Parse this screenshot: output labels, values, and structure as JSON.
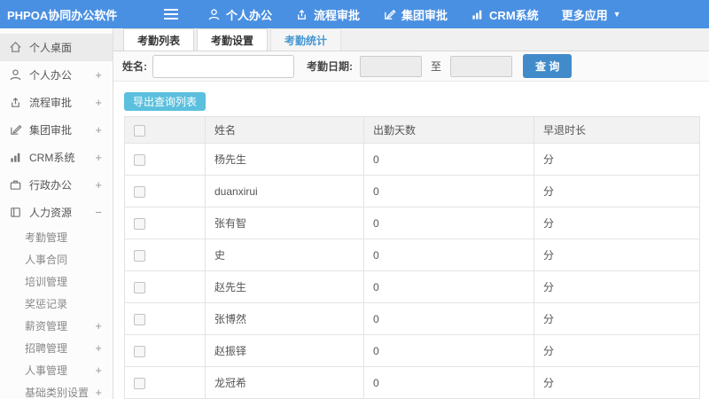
{
  "app": {
    "title": "PHPOA协同办公软件"
  },
  "topnav": {
    "items": [
      {
        "label": "个人办公"
      },
      {
        "label": "流程审批"
      },
      {
        "label": "集团审批"
      },
      {
        "label": "CRM系统"
      },
      {
        "label": "更多应用"
      }
    ]
  },
  "sidebar": {
    "items": [
      {
        "label": "个人桌面",
        "expander": ""
      },
      {
        "label": "个人办公",
        "expander": "+"
      },
      {
        "label": "流程审批",
        "expander": "+"
      },
      {
        "label": "集团审批",
        "expander": "+"
      },
      {
        "label": "CRM系统",
        "expander": "+"
      },
      {
        "label": "行政办公",
        "expander": "+"
      },
      {
        "label": "人力资源",
        "expander": "−"
      }
    ],
    "subitems": [
      {
        "label": "考勤管理",
        "expander": ""
      },
      {
        "label": "人事合同",
        "expander": ""
      },
      {
        "label": "培训管理",
        "expander": ""
      },
      {
        "label": "奖惩记录",
        "expander": ""
      },
      {
        "label": "薪资管理",
        "expander": "+"
      },
      {
        "label": "招聘管理",
        "expander": "+"
      },
      {
        "label": "人事管理",
        "expander": "+"
      },
      {
        "label": "基础类别设置",
        "expander": "+"
      }
    ]
  },
  "tabs": [
    {
      "label": "考勤列表"
    },
    {
      "label": "考勤设置"
    },
    {
      "label": "考勤统计"
    }
  ],
  "filter": {
    "name_label": "姓名:",
    "date_label": "考勤日期:",
    "to_label": "至",
    "search_label": "查 询"
  },
  "toolbar": {
    "export_label": "导出查询列表"
  },
  "table": {
    "headers": {
      "name": "姓名",
      "days": "出勤天数",
      "early": "早退时长"
    },
    "rows": [
      {
        "name": "杨先生",
        "days": "0",
        "early": "分"
      },
      {
        "name": "duanxirui",
        "days": "0",
        "early": "分"
      },
      {
        "name": "张有智",
        "days": "0",
        "early": "分"
      },
      {
        "name": "史",
        "days": "0",
        "early": "分"
      },
      {
        "name": "赵先生",
        "days": "0",
        "early": "分"
      },
      {
        "name": "张博然",
        "days": "0",
        "early": "分"
      },
      {
        "name": "赵振铎",
        "days": "0",
        "early": "分"
      },
      {
        "name": "龙冠希",
        "days": "0",
        "early": "分"
      }
    ]
  },
  "colors": {
    "topbar": "#4a90e2",
    "primary_button": "#428bca",
    "export_button": "#5bc0de",
    "active_tab_text": "#4596d2"
  }
}
